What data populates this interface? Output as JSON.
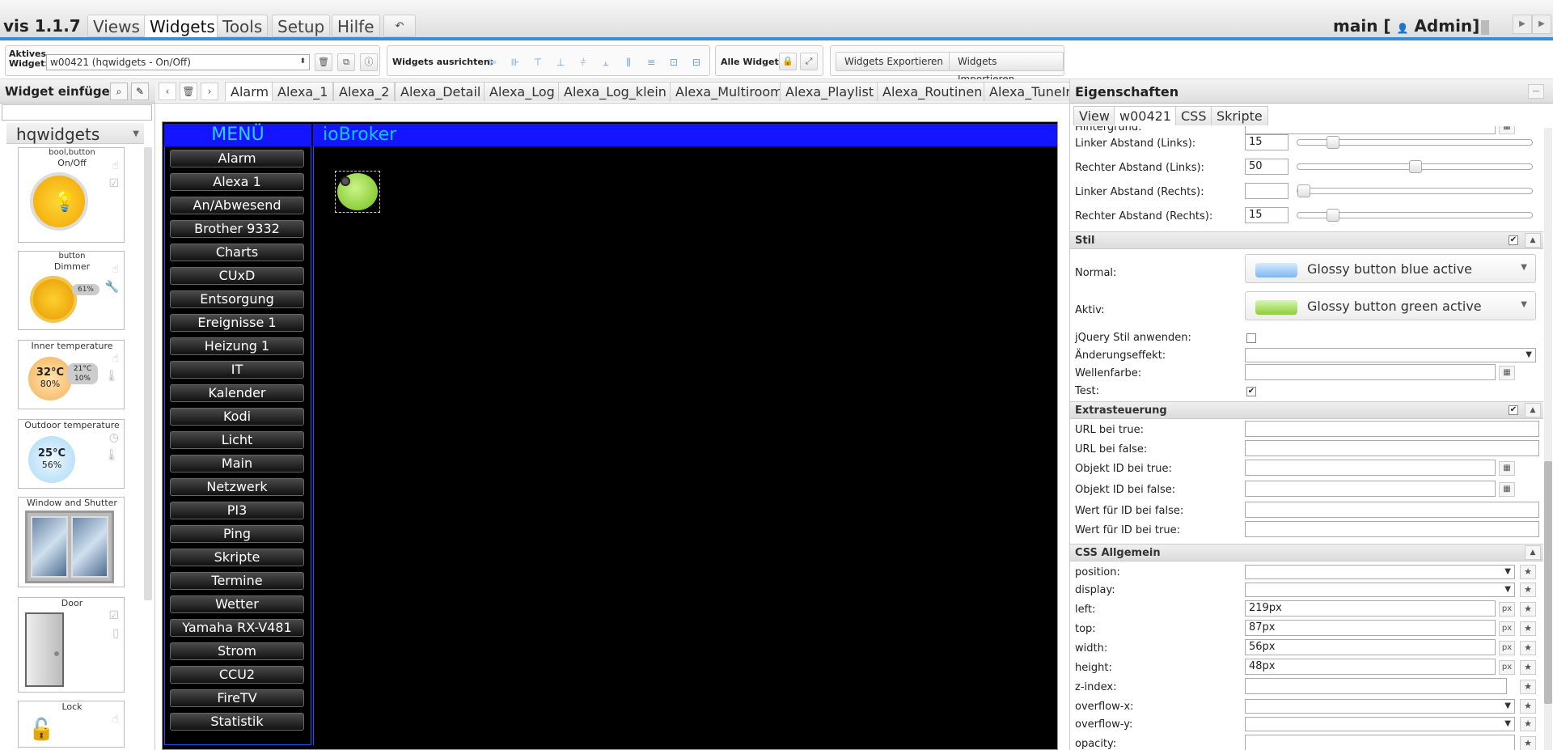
{
  "app": {
    "title": "vis 1.1.7"
  },
  "main_tabs": [
    {
      "label": "Views"
    },
    {
      "label": "Widgets"
    },
    {
      "label": "Tools"
    },
    {
      "label": "Setup"
    },
    {
      "label": "Hilfe"
    }
  ],
  "undo_icon": "undo-icon",
  "view_info": {
    "label": "main [",
    "user": "Admin]"
  },
  "toolbar": {
    "active_widget_label": "Aktives Widget:",
    "active_widget_value": "w00421 (hqwidgets - On/Off)",
    "align_label": "Widgets ausrichten:",
    "all_widgets_label": "Alle Widgets:",
    "export_label": "Widgets Exportieren",
    "import_label": "Widgets Importieren"
  },
  "left_panel": {
    "title": "Widget einfügen",
    "widget_set": "hqwidgets",
    "widgets": [
      {
        "title": "bool,button",
        "subtitle": "On/Off"
      },
      {
        "title": "button",
        "subtitle": "Dimmer",
        "value": "61%"
      },
      {
        "title": "Inner temperature",
        "temp": "32°C",
        "hum": "80%",
        "set_temp": "21°C",
        "set_hum": "10%"
      },
      {
        "title": "Outdoor temperature",
        "temp": "25°C",
        "hum": "56%"
      },
      {
        "title": "Window and Shutter"
      },
      {
        "title": "Door"
      },
      {
        "title": "Lock"
      }
    ]
  },
  "view_tabs": [
    "Alarm",
    "Alexa_1",
    "Alexa_2",
    "Alexa_Detail",
    "Alexa_Log",
    "Alexa_Log_klein",
    "Alexa_Multiroom",
    "Alexa_Playlist",
    "Alexa_Routinen",
    "Alexa_TuneIn"
  ],
  "canvas": {
    "menu_title": "MENÜ",
    "header_title": "ioBroker",
    "menu_items": [
      "Alarm",
      "Alexa 1",
      "An/Abwesend",
      "Brother 9332",
      "Charts",
      "CUxD",
      "Entsorgung",
      "Ereignisse 1",
      "Heizung 1",
      "IT",
      "Kalender",
      "Kodi",
      "Licht",
      "Main",
      "Netzwerk",
      "PI3",
      "Ping",
      "Skripte",
      "Termine",
      "Wetter",
      "Yamaha RX-V481",
      "Strom",
      "CCU2",
      "FireTV",
      "Statistik"
    ]
  },
  "props": {
    "title": "Eigenschaften",
    "tabs": [
      "View",
      "w00421",
      "CSS",
      "Skripte"
    ],
    "hintergrund_label": "Hintergrund:",
    "rows_margins": [
      {
        "label": "Linker Abstand (Links):",
        "value": "15"
      },
      {
        "label": "Rechter Abstand (Links):",
        "value": "50"
      },
      {
        "label": "Linker Abstand (Rechts):",
        "value": ""
      },
      {
        "label": "Rechter Abstand (Rechts):",
        "value": "15"
      }
    ],
    "stil": {
      "section": "Stil",
      "normal_label": "Normal:",
      "normal_value": "Glossy button blue active",
      "aktiv_label": "Aktiv:",
      "aktiv_value": "Glossy button green active",
      "jquery_label": "jQuery Stil anwenden:",
      "aenderung_label": "Änderungseffekt:",
      "wellen_label": "Wellenfarbe:",
      "test_label": "Test:"
    },
    "extra": {
      "section": "Extrasteuerung",
      "rows": [
        "URL bei true:",
        "URL bei false:",
        "Objekt ID bei true:",
        "Objekt ID bei false:",
        "Wert für ID bei false:",
        "Wert für ID bei true:"
      ]
    },
    "css": {
      "section": "CSS Allgemein",
      "position_label": "position:",
      "display_label": "display:",
      "left_label": "left:",
      "left_value": "219px",
      "top_label": "top:",
      "top_value": "87px",
      "width_label": "width:",
      "width_value": "56px",
      "height_label": "height:",
      "height_value": "48px",
      "zindex_label": "z-index:",
      "overflowx_label": "overflow-x:",
      "overflowy_label": "overflow-y:",
      "opacity_label": "opacity:",
      "unit": "px"
    }
  },
  "colors": {
    "accent": "#3b8ed6",
    "canvas_header": "#1414ff",
    "canvas_bg": "#000000"
  }
}
